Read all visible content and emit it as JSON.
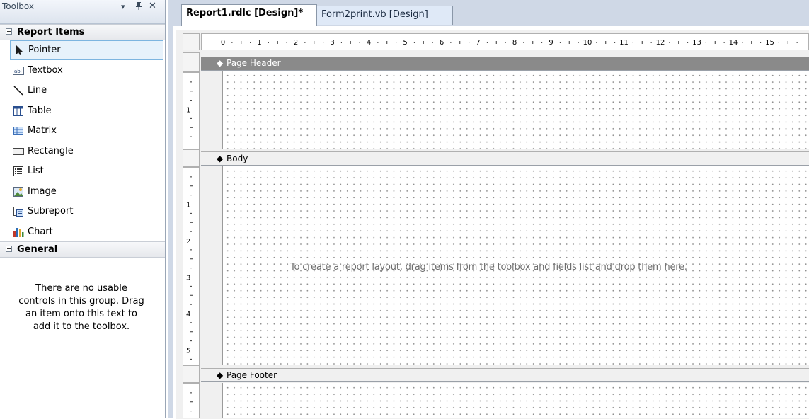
{
  "toolbox": {
    "title": "Toolbox",
    "controls": {
      "dropdown": "▾",
      "pin": "ꟷ",
      "close": "✕"
    },
    "groups": [
      {
        "label": "Report Items",
        "items": [
          {
            "label": "Pointer",
            "icon": "pointer-icon",
            "selected": true
          },
          {
            "label": "Textbox",
            "icon": "textbox-icon"
          },
          {
            "label": "Line",
            "icon": "line-icon"
          },
          {
            "label": "Table",
            "icon": "table-icon"
          },
          {
            "label": "Matrix",
            "icon": "matrix-icon"
          },
          {
            "label": "Rectangle",
            "icon": "rectangle-icon"
          },
          {
            "label": "List",
            "icon": "list-icon"
          },
          {
            "label": "Image",
            "icon": "image-icon"
          },
          {
            "label": "Subreport",
            "icon": "subreport-icon"
          },
          {
            "label": "Chart",
            "icon": "chart-icon"
          }
        ]
      },
      {
        "label": "General"
      }
    ],
    "empty_message": "There are no usable controls in this group. Drag an item onto this text to add it to the toolbox."
  },
  "tabs": [
    {
      "label": "Report1.rdlc [Design]*",
      "active": true
    },
    {
      "label": "Form2print.vb [Design]",
      "active": false
    }
  ],
  "ruler": {
    "labels": [
      "0",
      "1",
      "2",
      "3",
      "4",
      "5",
      "6",
      "7",
      "8",
      "9",
      "10",
      "11",
      "12",
      "13",
      "14",
      "15"
    ]
  },
  "sections": {
    "header": {
      "label": "Page Header",
      "ruler_labels": [
        "1"
      ]
    },
    "body": {
      "label": "Body",
      "ruler_labels": [
        "1",
        "2",
        "3",
        "4",
        "5"
      ]
    },
    "footer": {
      "label": "Page Footer"
    }
  },
  "hint": "To create a report layout, drag items from the toolbox and fields list and drop them here.",
  "colors": {
    "selection_border": "#7db5e0",
    "selection_fill": "#e7f2fb",
    "header_bar": "#8a8a8a",
    "doc_background": "#cfd8e6"
  }
}
